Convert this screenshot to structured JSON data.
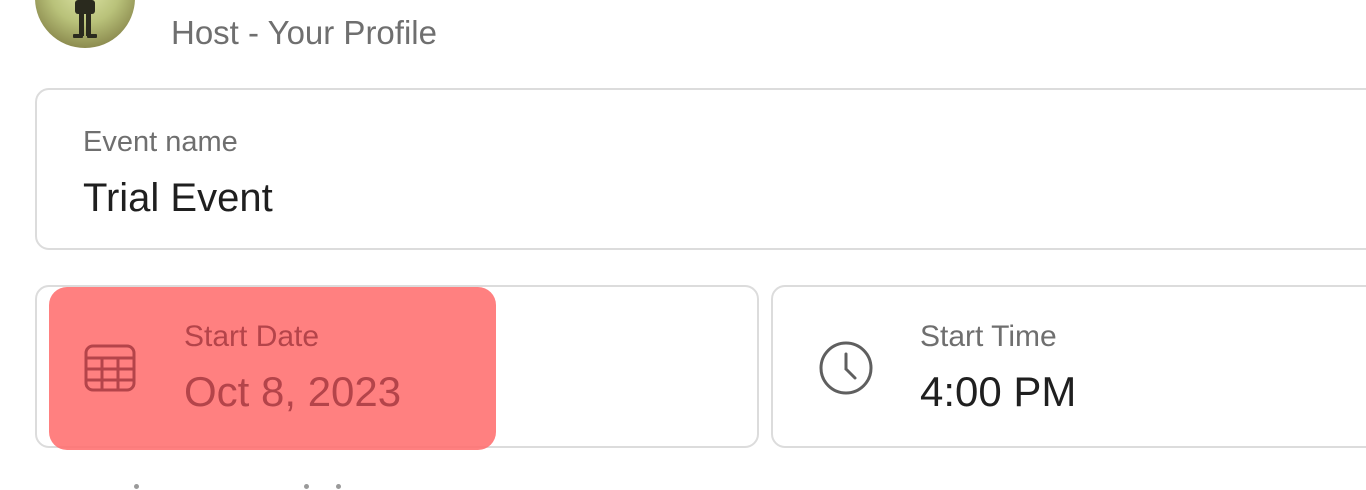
{
  "host": {
    "label": "Host - Your Profile",
    "avatar_icon": "profile-avatar"
  },
  "event_name": {
    "label": "Event name",
    "value": "Trial Event"
  },
  "start_date": {
    "label": "Start Date",
    "value": "Oct 8, 2023",
    "icon": "calendar-icon",
    "highlight_color": "#ff6e6e"
  },
  "start_time": {
    "label": "Start Time",
    "value": "4:00 PM",
    "icon": "clock-icon"
  },
  "colors": {
    "border": "#dcdcdc",
    "label_text": "#6f6f6f",
    "value_text": "#1f1f1f"
  }
}
